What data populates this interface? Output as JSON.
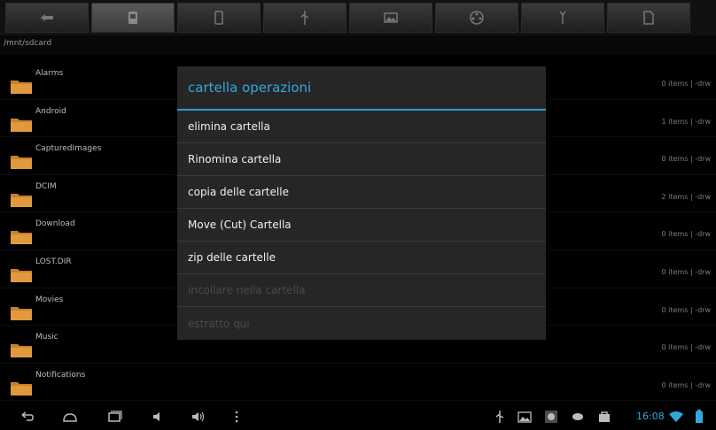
{
  "path": "/mnt/sdcard",
  "toolbar": {
    "buttons": [
      {
        "icon": "back-arrow-icon"
      },
      {
        "icon": "sdcard-icon",
        "active": true
      },
      {
        "icon": "phone-icon"
      },
      {
        "icon": "usb-icon"
      },
      {
        "icon": "image-icon"
      },
      {
        "icon": "film-reel-icon"
      },
      {
        "icon": "tools-icon"
      },
      {
        "icon": "document-icon"
      }
    ]
  },
  "folders": [
    {
      "name": "Alarms",
      "info": "0 items | -drw"
    },
    {
      "name": "Android",
      "info": "1 items | -drw"
    },
    {
      "name": "CapturedImages",
      "info": "0 items | -drw"
    },
    {
      "name": "DCIM",
      "info": "2 items | -drw"
    },
    {
      "name": "Download",
      "info": "0 items | -drw"
    },
    {
      "name": "LOST.DIR",
      "info": "0 items | -drw"
    },
    {
      "name": "Movies",
      "info": "0 items | -drw"
    },
    {
      "name": "Music",
      "info": "0 items | -drw"
    },
    {
      "name": "Notifications",
      "info": "0 items | -drw"
    }
  ],
  "dialog": {
    "title": "cartella operazioni",
    "items": [
      {
        "label": "elimina cartella",
        "enabled": true
      },
      {
        "label": "Rinomina cartella",
        "enabled": true
      },
      {
        "label": "copia delle cartelle",
        "enabled": true
      },
      {
        "label": "Move (Cut) Cartella",
        "enabled": true
      },
      {
        "label": "zip delle cartelle",
        "enabled": true
      },
      {
        "label": "incollare nella cartella",
        "enabled": false
      },
      {
        "label": "estratto qui",
        "enabled": false
      }
    ]
  },
  "statusbar": {
    "time": "16:08"
  },
  "colors": {
    "accent": "#33a7dc",
    "folder": "#c8812a"
  }
}
